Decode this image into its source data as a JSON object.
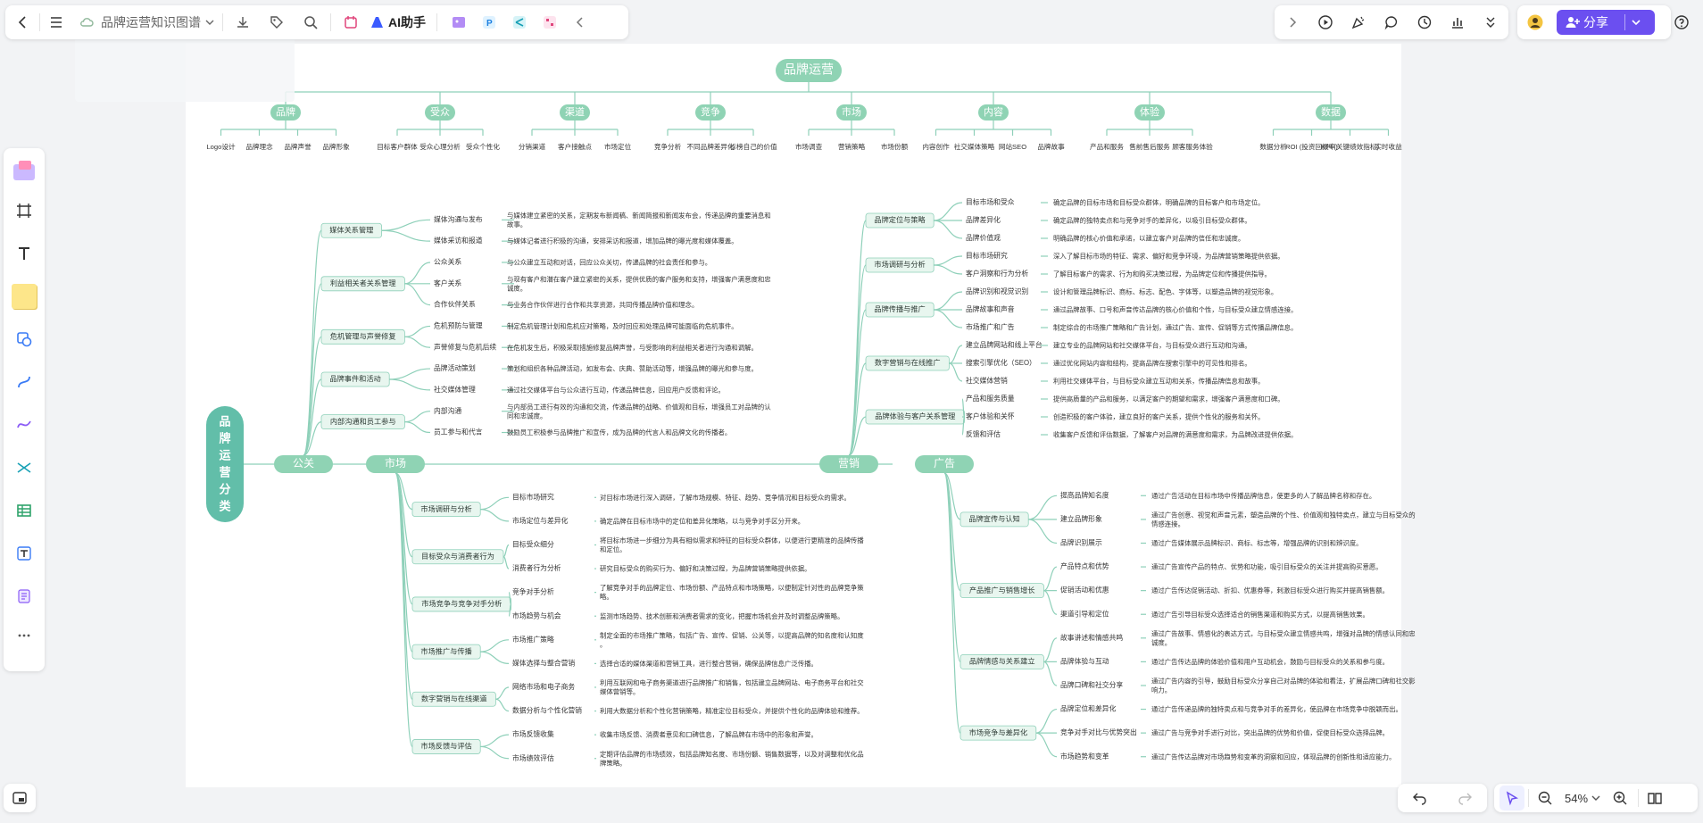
{
  "toolbar": {
    "doc_title": "品牌运营知识图谱",
    "ai_label": "AI助手",
    "share_label": "分享",
    "zoom": "54%"
  },
  "icons": [
    "back-icon",
    "menu-icon",
    "cloud-icon",
    "chevron-down-icon",
    "download-icon",
    "tag-icon",
    "search-icon",
    "app-icon",
    "play-icon",
    "comment-icon",
    "history-icon",
    "stats-icon",
    "undo-icon",
    "redo-icon",
    "pointer-icon",
    "zoom-out-icon",
    "zoom-in-icon",
    "book-icon"
  ],
  "top_map": {
    "root": "品牌运营",
    "branches": [
      {
        "label": "品牌",
        "leaves": [
          "Logo设计",
          "品牌理念",
          "品牌声誉",
          "品牌形象"
        ]
      },
      {
        "label": "受众",
        "leaves": [
          "目标客户群体",
          "受众心理分析",
          "受众个性化"
        ]
      },
      {
        "label": "渠道",
        "leaves": [
          "分销渠道",
          "客户接触点",
          "市场定位"
        ]
      },
      {
        "label": "竞争",
        "leaves": [
          "竞争分析",
          "不同品牌差异化",
          "标榜自己的价值"
        ]
      },
      {
        "label": "市场",
        "leaves": [
          "市场调查",
          "营销策略",
          "市场份额"
        ]
      },
      {
        "label": "内容",
        "leaves": [
          "内容创作",
          "社交媒体策略",
          "网站SEO",
          "品牌故事"
        ]
      },
      {
        "label": "体验",
        "leaves": [
          "产品和服务",
          "售前售后服务",
          "顾客服务体验"
        ]
      },
      {
        "label": "数据",
        "leaves": [
          "数据分析",
          "ROI (投资回报率)",
          "KPI (关键绩效指标)",
          "实时收益"
        ]
      }
    ]
  },
  "main_map": {
    "root": "品牌运营分类",
    "main": [
      "公关",
      "市场",
      "营销",
      "广告"
    ],
    "pr": [
      {
        "label": "媒体关系管理",
        "items": [
          {
            "k": "媒体沟通与发布",
            "v": "与媒体建立紧密的关系，定期发布新闻稿、新闻简报和新闻发布会，传递品牌的重要消息和故事。"
          },
          {
            "k": "媒体采访和报道",
            "v": "与媒体记者进行积极的沟通，安排采访和报道，增加品牌的曝光度和媒体覆盖。"
          }
        ]
      },
      {
        "label": "利益相关者关系管理",
        "items": [
          {
            "k": "公众关系",
            "v": "与公众建立互动和对话，回应公众关切，传递品牌的社会责任和参与。"
          },
          {
            "k": "客户关系",
            "v": "与现有客户和潜在客户建立紧密的关系，提供优质的客户服务和支持，增强客户满意度和忠诚度。"
          },
          {
            "k": "合作伙伴关系",
            "v": "与业务合作伙伴进行合作和共享资源，共同传播品牌价值和理念。"
          }
        ]
      },
      {
        "label": "危机管理与声誉修复",
        "items": [
          {
            "k": "危机预防与管理",
            "v": "制定危机管理计划和危机应对策略，及时回应和处理品牌可能面临的危机事件。"
          },
          {
            "k": "声誉修复与危机后续",
            "v": "在危机发生后，积极采取措施修复品牌声誉，与受影响的利益相关者进行沟通和调解。"
          }
        ]
      },
      {
        "label": "品牌事件和活动",
        "items": [
          {
            "k": "品牌活动策划",
            "v": "策划和组织各种品牌活动，如发布会、庆典、赞助活动等，增强品牌的曝光和参与度。"
          },
          {
            "k": "社交媒体管理",
            "v": "通过社交媒体平台与公众进行互动，传递品牌信息，回应用户反馈和评论。"
          }
        ]
      },
      {
        "label": "内部沟通和员工参与",
        "items": [
          {
            "k": "内部沟通",
            "v": "与内部员工进行有效的沟通和交流，传递品牌的战略、价值观和目标，增强员工对品牌的认同和忠诚度。"
          },
          {
            "k": "员工参与和代言",
            "v": "鼓励员工积极参与品牌推广和宣传，成为品牌的代言人和品牌文化的传播者。"
          }
        ]
      }
    ],
    "market": [
      {
        "label": "市场调研与分析",
        "items": [
          {
            "k": "目标市场研究",
            "v": "对目标市场进行深入调研，了解市场规模、特征、趋势、竞争情况和目标受众的需求。"
          },
          {
            "k": "市场定位与差异化",
            "v": "确定品牌在目标市场中的定位和差异化策略，以与竞争对手区分开来。"
          }
        ]
      },
      {
        "label": "目标受众与消费者行为",
        "items": [
          {
            "k": "目标受众细分",
            "v": "将目标市场进一步细分为具有相似需求和特征的目标受众群体，以便进行更精准的品牌传播和定位。"
          },
          {
            "k": "消费者行为分析",
            "v": "研究目标受众的购买行为、偏好和决策过程，为品牌营销策略提供依据。"
          }
        ]
      },
      {
        "label": "市场竞争与竞争对手分析",
        "items": [
          {
            "k": "竞争对手分析",
            "v": "了解竞争对手的品牌定位、市场份额、产品特点和市场策略，以便制定针对性的品牌竞争策略。"
          },
          {
            "k": "市场趋势与机会",
            "v": "监测市场趋势、技术创新和消费者需求的变化，把握市场机会并及时调整品牌策略。"
          }
        ]
      },
      {
        "label": "市场推广与传播",
        "items": [
          {
            "k": "市场推广策略",
            "v": "制定全面的市场推广策略，包括广告、宣传、促销、公关等，以提高品牌的知名度和认知度。"
          },
          {
            "k": "媒体选择与整合营销",
            "v": "选择合适的媒体渠道和营销工具，进行整合营销，确保品牌信息广泛传播。"
          }
        ]
      },
      {
        "label": "数字营销与在线渠道",
        "items": [
          {
            "k": "网络市场和电子商务",
            "v": "利用互联网和电子商务渠道进行品牌推广和销售，包括建立品牌网站、电子商务平台和社交媒体营销等。"
          },
          {
            "k": "数据分析与个性化营销",
            "v": "利用大数据分析和个性化营销策略，精准定位目标受众，并提供个性化的品牌体验和推荐。"
          }
        ]
      },
      {
        "label": "市场反馈与评估",
        "items": [
          {
            "k": "市场反馈收集",
            "v": "收集市场反馈、消费者意见和口碑信息，了解品牌在市场中的形象和声誉。"
          },
          {
            "k": "市场绩效评估",
            "v": "定期评估品牌的市场绩效，包括品牌知名度、市场份额、销售数据等，以及对调整和优化品牌策略。"
          }
        ]
      }
    ],
    "marketing": [
      {
        "label": "品牌定位与策略",
        "items": [
          {
            "k": "目标市场和受众",
            "v": "确定品牌的目标市场和目标受众群体，明确品牌的目标客户和市场定位。"
          },
          {
            "k": "品牌差异化",
            "v": "确定品牌的独特卖点和与竞争对手的差异化，以吸引目标受众群体。"
          },
          {
            "k": "品牌价值观",
            "v": "明确品牌的核心价值和承诺，以建立客户对品牌的信任和忠诚度。"
          }
        ]
      },
      {
        "label": "市场调研与分析",
        "items": [
          {
            "k": "目标市场研究",
            "v": "深入了解目标市场的特征、需求、偏好和竞争环境，为品牌营销策略提供依据。"
          },
          {
            "k": "客户洞察和行为分析",
            "v": "了解目标客户的需求、行为和购买决策过程，为品牌定位和传播提供指导。"
          }
        ]
      },
      {
        "label": "品牌传播与推广",
        "items": [
          {
            "k": "品牌识别和视觉识别",
            "v": "设计和管理品牌标识、商标、标志、配色、字体等，以塑造品牌的视觉形象。"
          },
          {
            "k": "品牌故事和声音",
            "v": "通过品牌故事、口号和声音传达品牌的核心价值和个性，与目标受众建立情感连接。"
          },
          {
            "k": "市场推广和广告",
            "v": "制定综合的市场推广策略和广告计划，通过广告、宣传、促销等方式传播品牌信息。"
          }
        ]
      },
      {
        "label": "数字营销与在线推广",
        "items": [
          {
            "k": "建立品牌网站和线上平台",
            "v": "建立专业的品牌网站和社交媒体平台，与目标受众进行互动和沟通。"
          },
          {
            "k": "搜索引擎优化（SEO）",
            "v": "通过优化网站内容和结构，提高品牌在搜索引擎中的可见性和排名。"
          },
          {
            "k": "社交媒体营销",
            "v": "利用社交媒体平台，与目标受众建立互动和关系，传播品牌信息和故事。"
          }
        ]
      },
      {
        "label": "品牌体验与客户关系管理",
        "items": [
          {
            "k": "产品和服务质量",
            "v": "提供高质量的产品和服务，以满足客户的期望和需求，增强客户满意度和口碑。"
          },
          {
            "k": "客户体验和关怀",
            "v": "创造积极的客户体验，建立良好的客户关系，提供个性化的服务和关怀。"
          },
          {
            "k": "反馈和评估",
            "v": "收集客户反馈和评估数据，了解客户对品牌的满意度和需求，为品牌改进提供依据。"
          }
        ]
      }
    ],
    "ad": [
      {
        "label": "品牌宣传与认知",
        "items": [
          {
            "k": "提高品牌知名度",
            "v": "通过广告活动在目标市场中传播品牌信息，使更多的人了解品牌名称和存在。"
          },
          {
            "k": "建立品牌形象",
            "v": "通过广告创意、视觉和声音元素，塑造品牌的个性、价值观和独特卖点，建立与目标受众的情感连接。"
          },
          {
            "k": "品牌识别展示",
            "v": "通过广告媒体展示品牌标识、商标、标志等，增强品牌的识别和辨识度。"
          }
        ]
      },
      {
        "label": "产品推广与销售增长",
        "items": [
          {
            "k": "产品特点和优势",
            "v": "通过广告宣传产品的特点、优势和功能，吸引目标受众的关注并提高购买意愿。"
          },
          {
            "k": "促销活动和优惠",
            "v": "通过广告传达促销活动、折扣、优惠券等，刺激目标受众进行购买并提高销售额。"
          },
          {
            "k": "渠道引导和定位",
            "v": "通过广告引导目标受众选择适合的销售渠道和购买方式，以提高销售效果。"
          }
        ]
      },
      {
        "label": "品牌情感与关系建立",
        "items": [
          {
            "k": "故事讲述和情感共鸣",
            "v": "通过广告故事、情感化的表达方式，与目标受众建立情感共鸣，增强对品牌的情感认同和忠诚度。"
          },
          {
            "k": "品牌体验与互动",
            "v": "通过广告传达品牌的体验价值和用户互动机会，鼓励与目标受众的关系和参与度。"
          },
          {
            "k": "品牌口碑和社交分享",
            "v": "通过广告内容的引导，鼓励目标受众分享自己对品牌的体验和看法，扩展品牌口碑和社交影响力。"
          }
        ]
      },
      {
        "label": "市场竞争与差异化",
        "items": [
          {
            "k": "品牌定位和差异化",
            "v": "通过广告传递品牌的独特卖点和与竞争对手的差异化，使品牌在市场竞争中脱颖而出。"
          },
          {
            "k": "竞争对手对比与优势突出",
            "v": "通过广告与竞争对手进行对比，突出品牌的优势和价值，促使目标受众选择品牌。"
          },
          {
            "k": "市场趋势和变革",
            "v": "通过广告传达品牌对市场趋势和变革的洞察和回应，体现品牌的创新性和适应能力。"
          }
        ]
      }
    ]
  },
  "colors": {
    "accent": "#6b4ff0",
    "node": "#8fd3b4",
    "root": "#62bea9",
    "line": "#8ed0b9",
    "sub_node": "#e8f6ef"
  }
}
